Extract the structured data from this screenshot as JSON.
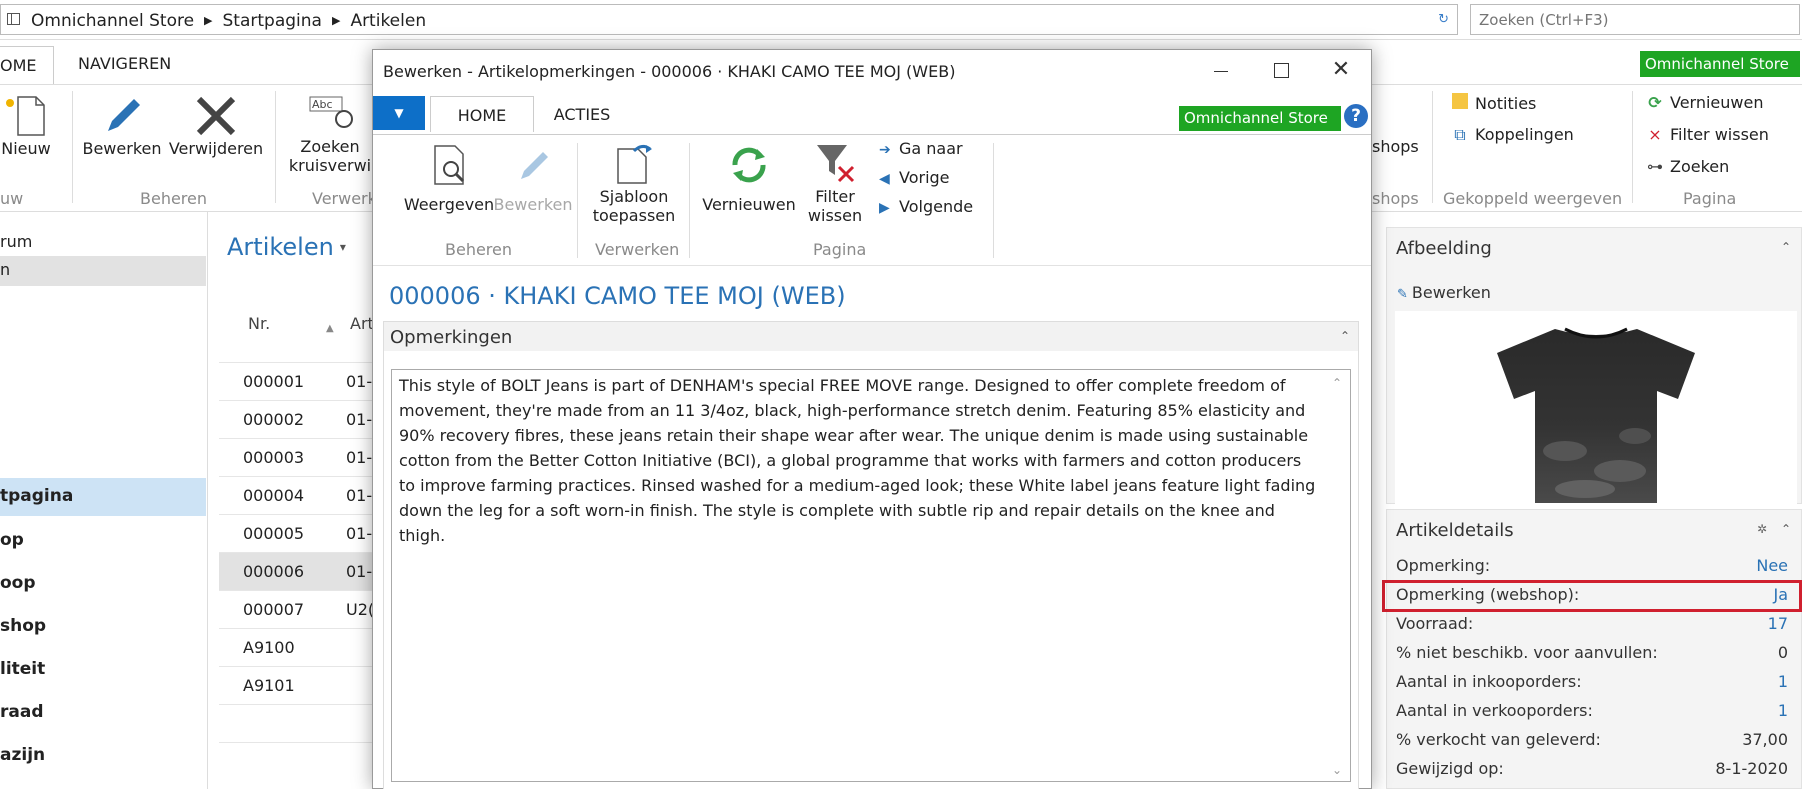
{
  "address": {
    "breadcrumb": [
      "Omnichannel Store",
      "Startpagina",
      "Artikelen"
    ],
    "search_placeholder": "Zoeken (Ctrl+F3)"
  },
  "bg_ribbon": {
    "tabs": {
      "home": "OME",
      "nav": "NAVIGEREN"
    },
    "brand": "Omnichannel Store",
    "buttons": {
      "new": "Nieuw",
      "edit": "Bewerken",
      "delete": "Verwijderen",
      "find_line1": "Zoeken",
      "find_line2": "kruisverwi"
    },
    "groups": {
      "new_g": "uw",
      "manage": "Beheren",
      "process": "Verwerk",
      "shops": "shops",
      "linked": "Gekoppeld weergeven",
      "page": "Pagina"
    },
    "shops_btn": "shops",
    "notes": "Notities",
    "links": "Koppelingen",
    "refresh": "Vernieuwen",
    "clear_filter": "Filter wissen",
    "find": "Zoeken"
  },
  "left_nav": {
    "items": [
      "rum",
      "n",
      "tpagina",
      "op",
      "oop",
      "shop",
      "liteit",
      "raad",
      "azijn"
    ]
  },
  "list": {
    "title": "Artikelen",
    "col_nr": "Nr.",
    "col_art": "Art",
    "rows": [
      {
        "nr": "000001",
        "art": "01-"
      },
      {
        "nr": "000002",
        "art": "01-"
      },
      {
        "nr": "000003",
        "art": "01-"
      },
      {
        "nr": "000004",
        "art": "01-"
      },
      {
        "nr": "000005",
        "art": "01-"
      },
      {
        "nr": "000006",
        "art": "01-"
      },
      {
        "nr": "000007",
        "art": "U2("
      },
      {
        "nr": "A9100",
        "art": ""
      },
      {
        "nr": "A9101",
        "art": ""
      }
    ]
  },
  "factbox": {
    "image_title": "Afbeelding",
    "image_edit": "Bewerken",
    "details_title": "Artikeldetails",
    "details": [
      {
        "k": "Opmerking:",
        "v": "Nee",
        "link": true
      },
      {
        "k": "Opmerking (webshop):",
        "v": "Ja",
        "link": true
      },
      {
        "k": "Voorraad:",
        "v": "17",
        "link": true
      },
      {
        "k": "% niet beschikb. voor aanvullen:",
        "v": "0",
        "link": false
      },
      {
        "k": "Aantal in inkooporders:",
        "v": "1",
        "link": true
      },
      {
        "k": "Aantal in verkooporders:",
        "v": "1",
        "link": true
      },
      {
        "k": "% verkocht van geleverd:",
        "v": "37,00",
        "link": false
      },
      {
        "k": "Gewijzigd op:",
        "v": "8-1-2020",
        "link": false
      }
    ]
  },
  "dialog": {
    "title": "Bewerken - Artikelopmerkingen - 000006 · KHAKI CAMO TEE MOJ (WEB)",
    "tabs": {
      "home": "HOME",
      "acties": "ACTIES"
    },
    "brand": "Omnichannel Store",
    "help": "?",
    "buttons": {
      "view": "Weergeven",
      "edit": "Bewerken",
      "template_line1": "Sjabloon",
      "template_line2": "toepassen",
      "refresh": "Vernieuwen",
      "filter_line1": "Filter",
      "filter_line2": "wissen",
      "goto": "Ga naar",
      "previous": "Vorige",
      "next": "Volgende"
    },
    "groups": {
      "manage": "Beheren",
      "process": "Verwerken",
      "page": "Pagina"
    },
    "heading": "000006 · KHAKI CAMO TEE MOJ (WEB)",
    "section_title": "Opmerkingen",
    "remarks": "This style of BOLT Jeans is part of DENHAM's special FREE MOVE range. Designed to offer complete freedom of movement, they're made from an 11 3/4oz, black, high-performance stretch denim. Featuring 85% elasticity and 90% recovery fibres, these jeans retain their shape wear after wear. The unique denim is made using sustainable cotton from the Better Cotton Initiative (BCI), a global programme that works with farmers and cotton producers to improve farming practices. Rinsed washed for a medium-aged look; these White label jeans feature light fading down the leg for a soft worn-in finish. The style is complete with subtle rip and repair details on the knee and thigh."
  },
  "colors": {
    "brand_green": "#1ea523",
    "accent_blue": "#2a72b5",
    "highlight_red": "#d0202f"
  }
}
